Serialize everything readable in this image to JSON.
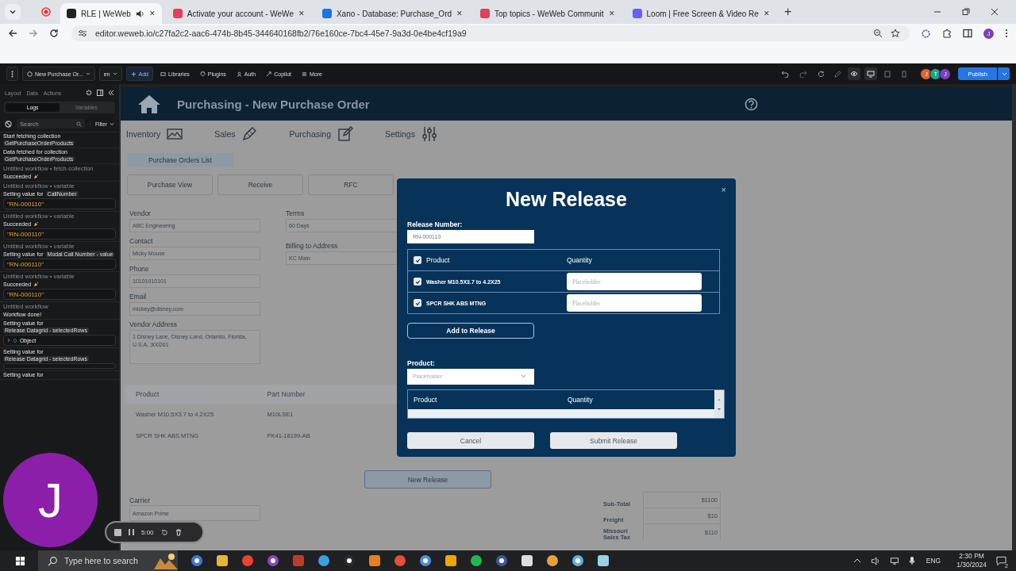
{
  "browser": {
    "tabs": [
      {
        "title": "RLE | WeWeb",
        "selected": true,
        "audio": true
      },
      {
        "title": "Activate your account - WeWe",
        "selected": false,
        "audio": false
      },
      {
        "title": "Xano - Database: Purchase_Ord",
        "selected": false,
        "audio": false
      },
      {
        "title": "Top topics - WeWeb Communit",
        "selected": false,
        "audio": false
      },
      {
        "title": "Loom | Free Screen & Video Re",
        "selected": false,
        "audio": false
      }
    ],
    "close": "✕",
    "new_tab": "+",
    "url": "editor.weweb.io/c27fa2c2-aac6-474b-8b45-344640168fb2/76e160ce-7bc4-45e7-9a3d-0e4be4cf19a9",
    "profile": "J"
  },
  "editor_toolbar": {
    "page": "New Purchase Or...",
    "language": "en",
    "add": "Add",
    "menu": [
      "Libraries",
      "Plugins",
      "Auth",
      "Copilot",
      "More"
    ],
    "collaborators": [
      {
        "initial": "J",
        "color": "#e0632f"
      },
      {
        "initial": "T",
        "color": "#1fa58c"
      },
      {
        "initial": "J",
        "color": "#7d3fc0"
      }
    ],
    "publish": "Publish"
  },
  "left_panel": {
    "tabs": [
      "Layout",
      "Data",
      "Actions"
    ],
    "segments": [
      {
        "label": "Logs",
        "selected": true
      },
      {
        "label": "Variables",
        "selected": false
      }
    ],
    "search": {
      "placeholder": "Search"
    },
    "filter": "Filter",
    "logs": [
      {
        "message": "Start fetching collection",
        "chip": "GetPurchaseOrderProducts"
      },
      {
        "message": "Data fetched for collection",
        "chip": "GetPurchaseOrderProducts"
      },
      {
        "source": "Untitled workflow • fetch-collection",
        "message": "Succeeded",
        "success": true
      },
      {
        "source": "Untitled workflow • variable",
        "message": "Setting value for",
        "chip": "CallNumber",
        "value": {
          "kind": "string",
          "text": "\"RN-000110\""
        }
      },
      {
        "source": "Untitled workflow • variable",
        "message": "Succeeded",
        "success": true,
        "value": {
          "kind": "string",
          "text": "\"RN-000110\""
        }
      },
      {
        "source": "Untitled workflow • variable",
        "message": "Setting value for",
        "chip": "Modal Call Number - value",
        "value": {
          "kind": "string",
          "text": "\"RN-000110\""
        }
      },
      {
        "source": "Untitled workflow • variable",
        "message": "Succeeded",
        "success": true,
        "value": {
          "kind": "string",
          "text": "\"RN-000110\""
        }
      },
      {
        "source": "Untitled workflow",
        "message": "Workflow done!"
      },
      {
        "message": "Setting value for",
        "chip": "Release Datagrid - selectedRows",
        "value": {
          "kind": "object",
          "index": "0",
          "text": "Object"
        }
      },
      {
        "message": "Setting value for",
        "chip": "Release Datagrid - selectedRows",
        "value": {
          "kind": "empty"
        }
      },
      {
        "message": "Setting value for"
      }
    ]
  },
  "app": {
    "title": "Purchasing - New Purchase Order",
    "nav": [
      "Inventory",
      "Sales",
      "Purchasing",
      "Settings"
    ],
    "list_button": "Purchase Orders List",
    "view_tabs": [
      "Purchase View",
      "Receive",
      "RFC"
    ],
    "fields_left": [
      {
        "label": "Vendor",
        "value": "ABC Engineering",
        "kind": "input"
      },
      {
        "label": "Contact",
        "value": "Micky Mouse",
        "kind": "input"
      },
      {
        "label": "Phone",
        "value": "10101010101",
        "kind": "input"
      },
      {
        "label": "Email",
        "value": "mickey@disney.com",
        "kind": "input"
      },
      {
        "label": "Vendor Address",
        "value": "1 Disney Lane, Disney Land, Orlando, Florida, U.S.A, 300261",
        "kind": "textarea"
      }
    ],
    "fields_right": [
      {
        "label": "Terms",
        "value": "60 Days",
        "kind": "input"
      },
      {
        "label": "Billing to Address",
        "value": "KC Main",
        "kind": "input"
      }
    ],
    "products_table": {
      "columns": [
        "Product",
        "Part Number"
      ],
      "rows": [
        [
          "Washer M10.5X3.7 to 4.2X25",
          "M10LSE1"
        ],
        [
          "SPCR SHK ABS MTNG",
          "PK41-18199-AB"
        ]
      ]
    },
    "new_release_button": "New Release",
    "carrier": {
      "label": "Carrier",
      "value": "Amazon Prime"
    },
    "totals": [
      {
        "label": "Sub-Total",
        "value": "$1100"
      },
      {
        "label": "Freight",
        "value": "$10"
      },
      {
        "label": "Missouri Sales Tax",
        "value": "$110"
      }
    ]
  },
  "modal": {
    "title": "New Release",
    "close": "×",
    "release_label": "Release Number:",
    "release_value": "RN-000110",
    "table": {
      "checked": true,
      "columns": [
        "Product",
        "Quantity"
      ],
      "rows": [
        {
          "product": "Washer M10.5X3.7 to 4.2X25",
          "checked": true,
          "placeholder": "Placeholder"
        },
        {
          "product": "SPCR SHK ABS MTNG",
          "checked": true,
          "placeholder": "Placeholder"
        }
      ]
    },
    "add_button": "Add to Release",
    "product_label": "Product:",
    "product_placeholder": "Placeholder",
    "release_table": {
      "columns": [
        "Product",
        "Quantity"
      ]
    },
    "cancel": "Cancel",
    "submit": "Submit Release"
  },
  "loom": {
    "avatar": "J",
    "timer": "5:00"
  },
  "taskbar": {
    "search_placeholder": "Type here to search",
    "language": "ENG",
    "time": "2:30 PM",
    "date": "1/30/2024",
    "notifications": "2"
  }
}
